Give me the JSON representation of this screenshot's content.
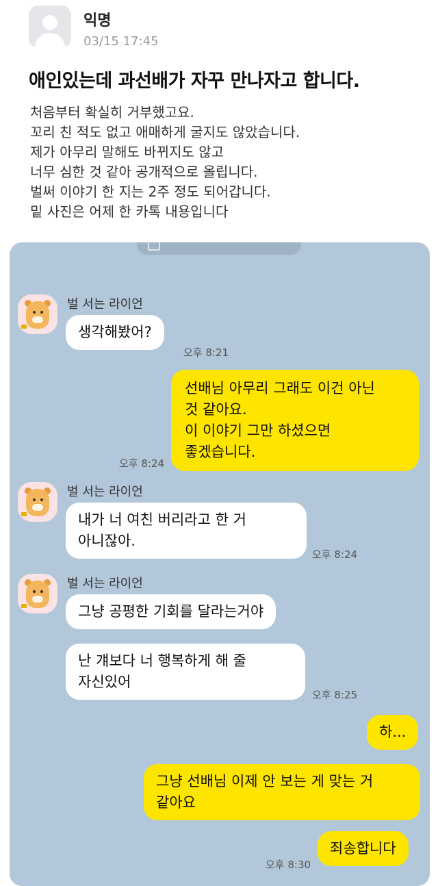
{
  "post": {
    "author": "익명",
    "date": "03/15 17:45",
    "title": "애인있는데 과선배가 자꾸 만나자고 합니다.",
    "body_lines": [
      "처음부터 확실히 거부했고요.",
      "꼬리 친 적도 없고 애매하게 굴지도 않았습니다.",
      "제가 아무리 말해도 바뀌지도 않고",
      "너무 심한 것 같아 공개적으로 올립니다.",
      "벌써 이야기 한 지는 2주 정도 되어갑니다.",
      "밑 사진은 어제 한 카톡 내용입니다"
    ]
  },
  "chat": {
    "sender_name": "벌 서는 라이언",
    "messages": [
      {
        "from": "other",
        "text": "생각해봤어?",
        "time": "오후 8:21"
      },
      {
        "from": "me",
        "lines": [
          "선배님 아무리 그래도 이건 아닌",
          "것 같아요.",
          "이 이야기 그만 하셨으면",
          "좋겠습니다."
        ],
        "time": "오후 8:24"
      },
      {
        "from": "other",
        "lines": [
          "내가 너 여친 버리라고 한 거",
          "아니잖아."
        ],
        "time": "오후 8:24"
      },
      {
        "from": "other",
        "text": "그냥 공평한 기회를 달라는거야"
      },
      {
        "from": "other",
        "lines": [
          "난 걔보다 너 행복하게 해 줄",
          "자신있어"
        ],
        "time": "오후 8:25"
      },
      {
        "from": "me",
        "text": "하..."
      },
      {
        "from": "me",
        "lines": [
          "그냥 선배님 이제 안 보는 게 맞는 거",
          "같아요"
        ]
      },
      {
        "from": "me",
        "text": "죄송합니다",
        "time": "오후 8:30"
      }
    ]
  }
}
